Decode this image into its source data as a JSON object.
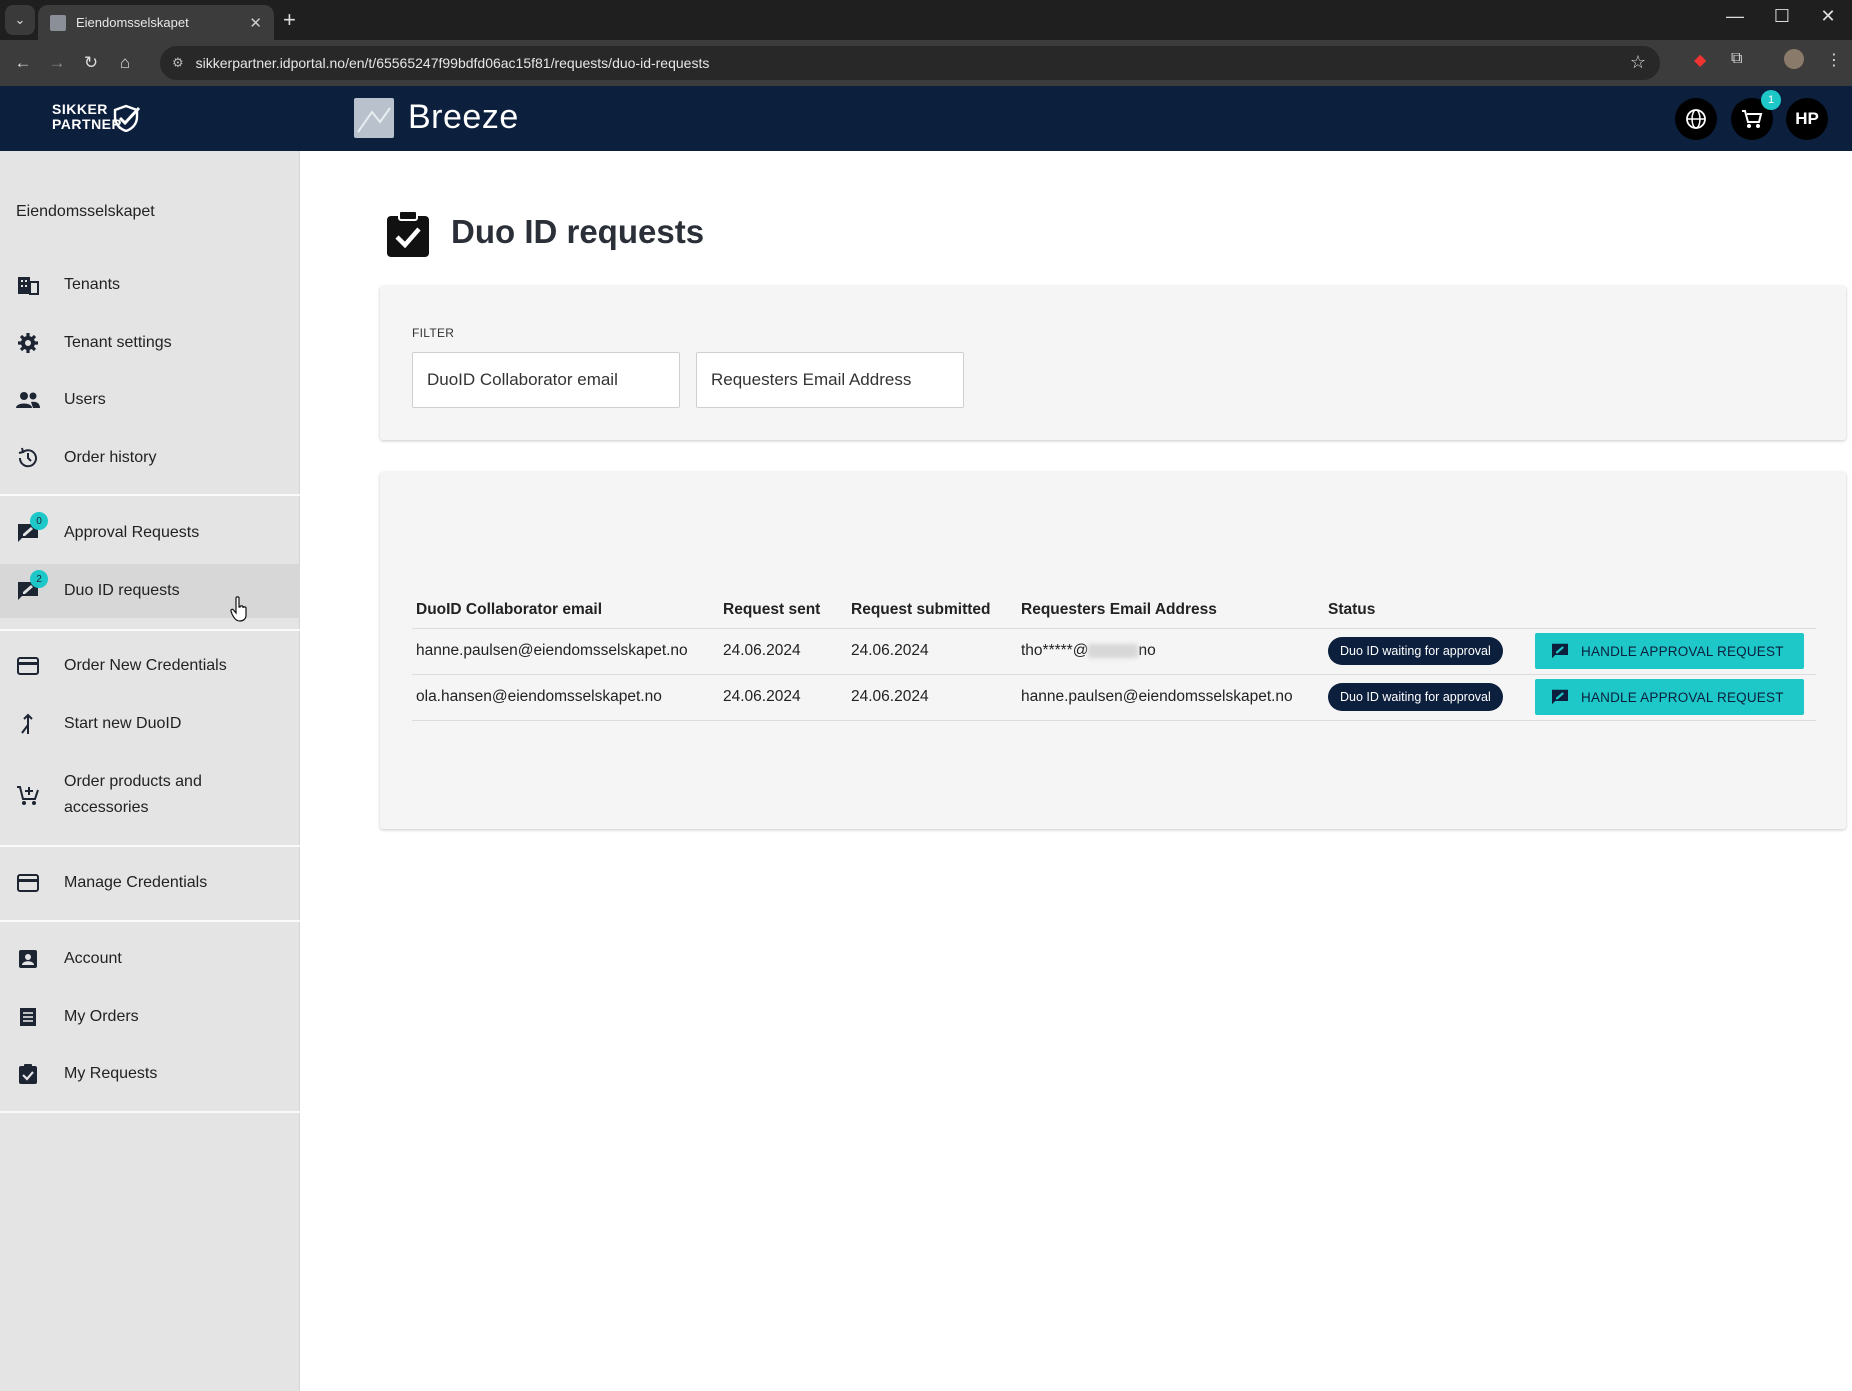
{
  "browser": {
    "tab_title": "Eiendomsselskapet",
    "url": "sikkerpartner.idportal.no/en/t/65565247f99bdfd06ac15f81/requests/duo-id-requests"
  },
  "header": {
    "brand_line1": "SIKKER",
    "brand_line2": "PARTNER",
    "app_name": "Breeze",
    "cart_count": "1",
    "avatar_initials": "HP"
  },
  "sidebar": {
    "tenant": "Eiendomsselskapet",
    "items": [
      {
        "label": "Tenants",
        "icon": "building-icon"
      },
      {
        "label": "Tenant settings",
        "icon": "gear-icon"
      },
      {
        "label": "Users",
        "icon": "people-icon"
      },
      {
        "label": "Order history",
        "icon": "history-icon"
      },
      {
        "label": "Approval Requests",
        "icon": "approval-icon",
        "badge": "0"
      },
      {
        "label": "Duo ID requests",
        "icon": "approval-icon",
        "badge": "2"
      },
      {
        "label": "Order New Credentials",
        "icon": "card-icon"
      },
      {
        "label": "Start new DuoID",
        "icon": "merge-icon"
      },
      {
        "label": "Order products and accessories",
        "icon": "cart-add-icon"
      },
      {
        "label": "Manage Credentials",
        "icon": "card-icon"
      },
      {
        "label": "Account",
        "icon": "account-box-icon"
      },
      {
        "label": "My Orders",
        "icon": "list-icon"
      },
      {
        "label": "My Requests",
        "icon": "clipboard-check-icon"
      }
    ]
  },
  "main": {
    "title": "Duo ID requests",
    "filter": {
      "label": "FILTER",
      "collaborator_placeholder": "DuoID Collaborator email",
      "requester_placeholder": "Requesters Email Address"
    },
    "table": {
      "columns": [
        "DuoID Collaborator email",
        "Request sent",
        "Request submitted",
        "Requesters Email Address",
        "Status",
        ""
      ],
      "rows": [
        {
          "collaborator": "hanne.paulsen@eiendomsselskapet.no",
          "sent": "24.06.2024",
          "submitted": "24.06.2024",
          "requester_prefix": "tho*****@",
          "requester_suffix": "no",
          "status": "Duo ID waiting for approval",
          "action": "HANDLE APPROVAL REQUEST"
        },
        {
          "collaborator": "ola.hansen@eiendomsselskapet.no",
          "sent": "24.06.2024",
          "submitted": "24.06.2024",
          "requester": "hanne.paulsen@eiendomsselskapet.no",
          "status": "Duo ID waiting for approval",
          "action": "HANDLE APPROVAL REQUEST"
        }
      ]
    }
  },
  "colors": {
    "header_bg": "#0c1f3d",
    "accent": "#1ec8c8",
    "sidebar_bg": "#e5e4e5"
  }
}
